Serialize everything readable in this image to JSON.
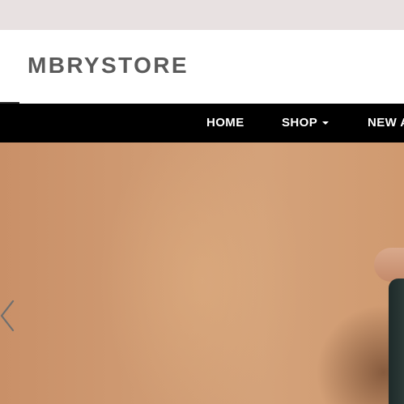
{
  "brand": {
    "logo_text": "MBRYSTORE"
  },
  "nav": {
    "items": [
      {
        "label": "HOME",
        "has_dropdown": false
      },
      {
        "label": "SHOP",
        "has_dropdown": true
      },
      {
        "label": "NEW A",
        "has_dropdown": false
      }
    ]
  },
  "hero": {
    "prev_icon": "chevron-left-icon"
  },
  "colors": {
    "topbar": "#e8e1e1",
    "header_bg": "#ffffff",
    "logo_text": "#5a5a5a",
    "navbar_bg": "#000000",
    "nav_text": "#ffffff",
    "hero_bg": "#cf9a72"
  }
}
